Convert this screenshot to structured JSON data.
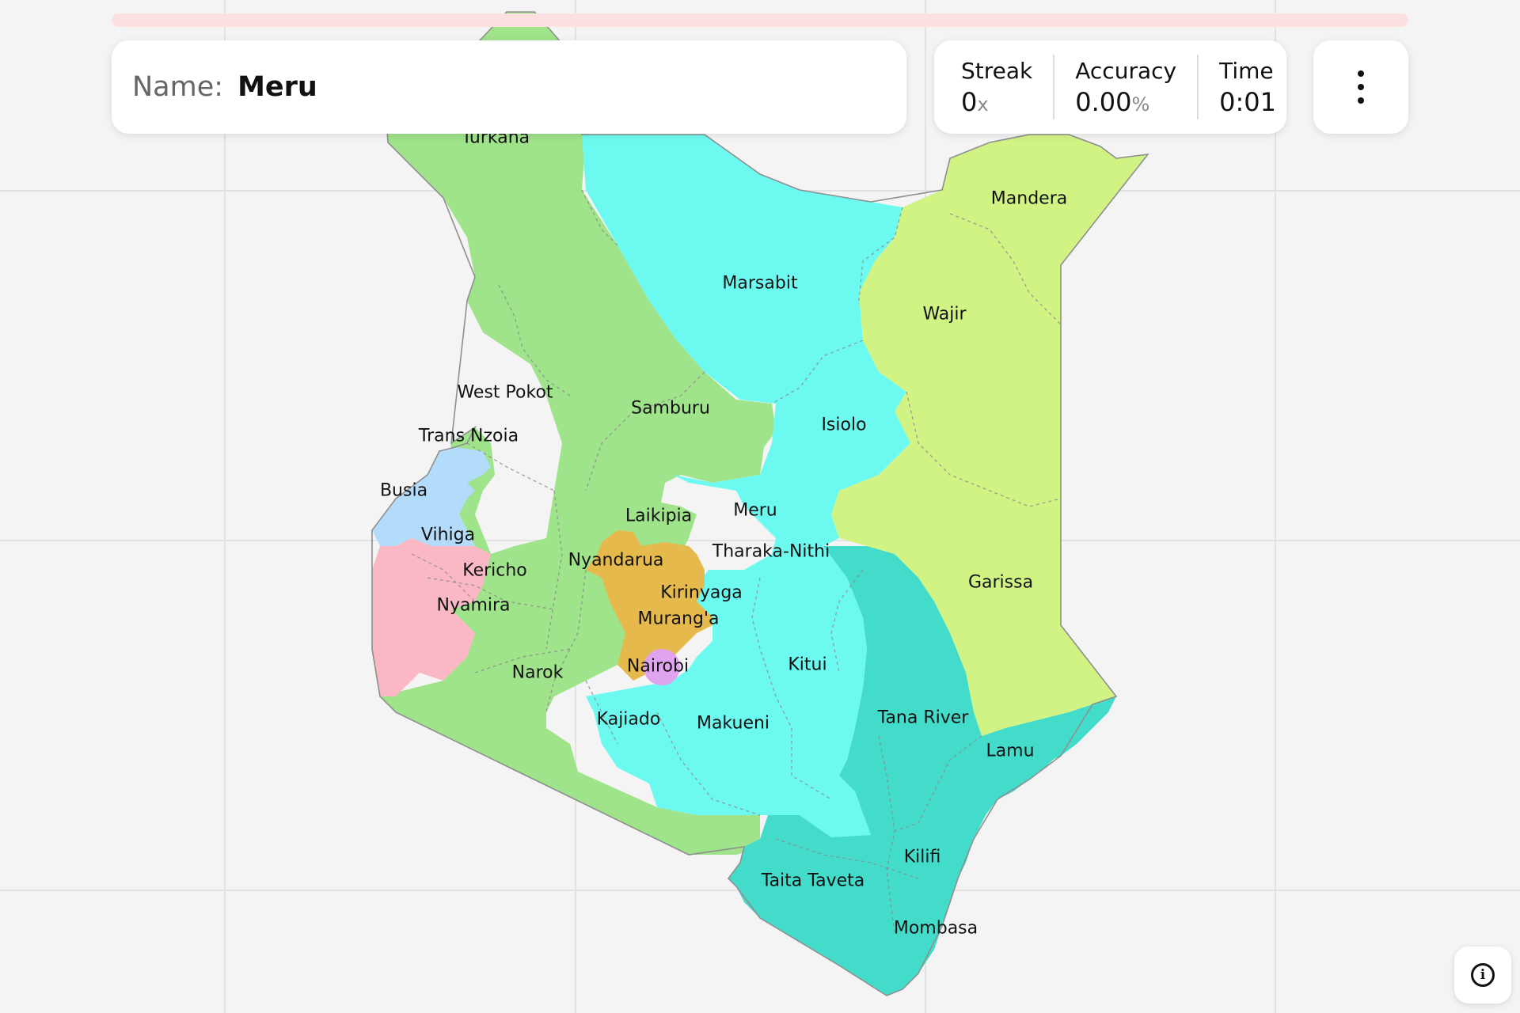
{
  "prompt": {
    "label": "Name:",
    "value": "Meru"
  },
  "progress": {
    "fraction": 0.98
  },
  "stats": [
    {
      "label": "Streak",
      "value": "0",
      "unit": "x"
    },
    {
      "label": "Accuracy",
      "value": "0.00",
      "unit": "%"
    },
    {
      "label": "Time",
      "value": "0:01",
      "unit": ""
    }
  ],
  "menu_icon": "kebab-menu-icon",
  "info_icon": "info-icon",
  "colors": {
    "rift_valley": "#9fe38a",
    "eastern": "#6cfaf0",
    "north_eastern": "#d1f384",
    "central": "#e6b94c",
    "western": "#b3dcfa",
    "nyanza": "#f9b8c3",
    "coast": "#43dccb",
    "nairobi": "#dfa3f0",
    "background": "#f4f4f4",
    "progress_track": "#fde0e0"
  },
  "county_labels": [
    "Turkana",
    "Marsabit",
    "Mandera",
    "Wajir",
    "West Pokot",
    "Samburu",
    "Isiolo",
    "Trans Nzoia",
    "Busia",
    "Meru",
    "Laikipia",
    "Vihiga",
    "Tharaka-Nithi",
    "Nyandarua",
    "Kericho",
    "Kirinyaga",
    "Garissa",
    "Nyamira",
    "Murang'a",
    "Nairobi",
    "Narok",
    "Kitui",
    "Kajiado",
    "Makueni",
    "Tana River",
    "Lamu",
    "Kilifi",
    "Taita Taveta",
    "Mombasa"
  ]
}
